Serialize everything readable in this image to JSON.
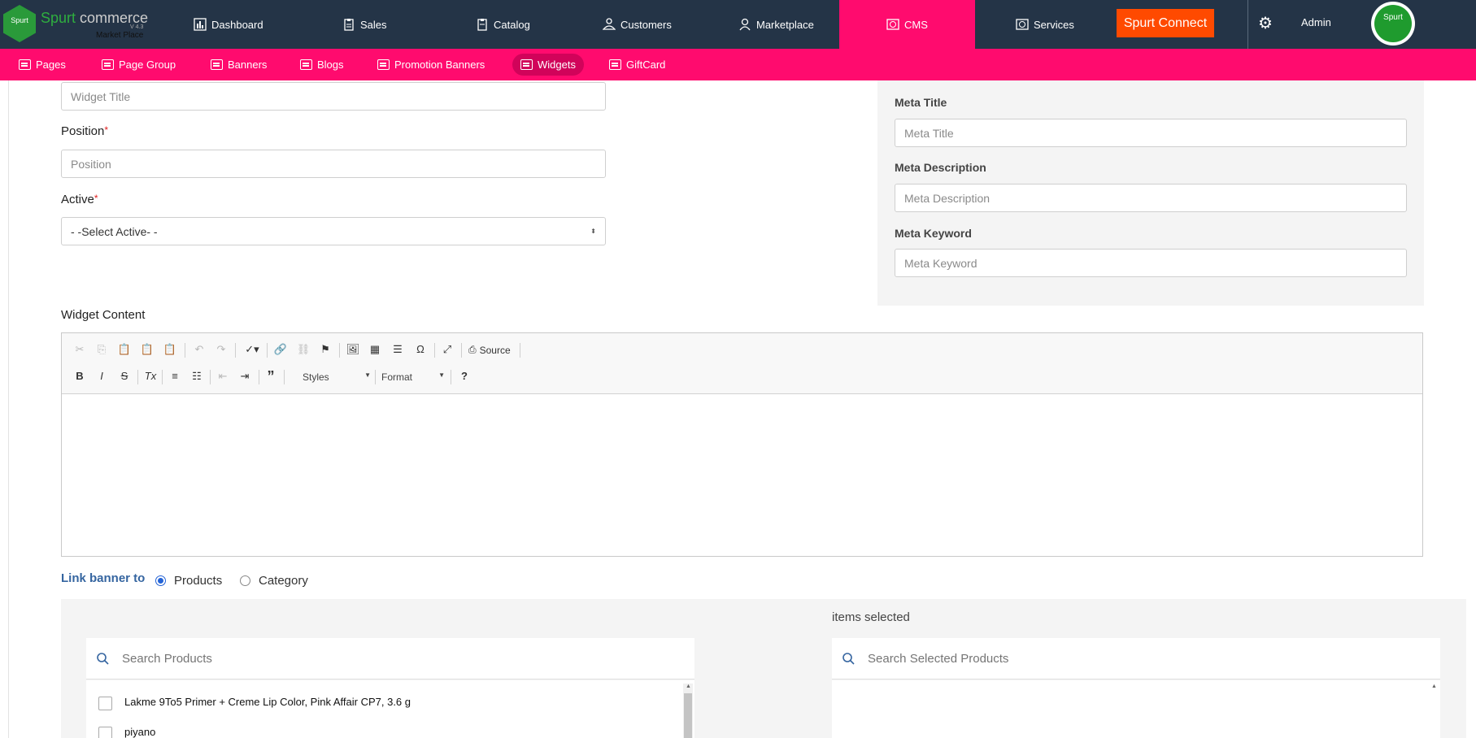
{
  "brand": {
    "name_part1": "Spurt",
    "name_part2": " commerce",
    "version": "V 4.3",
    "subtitle": "Market Place",
    "logo_text": "Spurt"
  },
  "nav": {
    "items": [
      {
        "label": "Dashboard",
        "icon": "bar-chart-icon"
      },
      {
        "label": "Sales",
        "icon": "clipboard-icon"
      },
      {
        "label": "Catalog",
        "icon": "clipboard-icon"
      },
      {
        "label": "Customers",
        "icon": "customers-icon"
      },
      {
        "label": "Marketplace",
        "icon": "user-icon"
      },
      {
        "label": "CMS",
        "icon": "globe-icon"
      },
      {
        "label": "Services",
        "icon": "globe-icon"
      }
    ],
    "spurt_connect": "Spurt Connect",
    "admin": "Admin",
    "avatar_text": "Spurt"
  },
  "subnav": {
    "items": [
      {
        "label": "Pages"
      },
      {
        "label": "Page Group"
      },
      {
        "label": "Banners"
      },
      {
        "label": "Blogs"
      },
      {
        "label": "Promotion Banners"
      },
      {
        "label": "Widgets"
      },
      {
        "label": "GiftCard"
      }
    ],
    "active": "Widgets"
  },
  "form": {
    "widget_title": {
      "placeholder": "Widget Title"
    },
    "position": {
      "label": "Position",
      "required": "*",
      "placeholder": "Position"
    },
    "active": {
      "label": "Active",
      "required": "*",
      "value": "- -Select Active- -"
    },
    "widget_content_label": "Widget Content"
  },
  "meta": {
    "title": {
      "label": "Meta Title",
      "placeholder": "Meta Title"
    },
    "description": {
      "label": "Meta Description",
      "placeholder": "Meta Description"
    },
    "keyword": {
      "label": "Meta Keyword",
      "placeholder": "Meta Keyword"
    }
  },
  "editor": {
    "source_label": "Source",
    "styles_label": "Styles",
    "format_label": "Format",
    "help_glyph": "?"
  },
  "link_banner": {
    "label": "Link banner to",
    "options": [
      "Products",
      "Category"
    ],
    "selected": "Products"
  },
  "picker": {
    "items_selected_label": "items selected",
    "search_placeholder": "Search Products",
    "selected_search_placeholder": "Search Selected Products",
    "products": [
      "Lakme 9To5 Primer + Creme Lip Color, Pink Affair CP7, 3.6 g",
      "piyano"
    ]
  },
  "colors": {
    "topbar": "#243447",
    "accent_pink": "#ff0b6e",
    "connect_orange": "#ff4a00",
    "link_blue": "#3565a0"
  }
}
